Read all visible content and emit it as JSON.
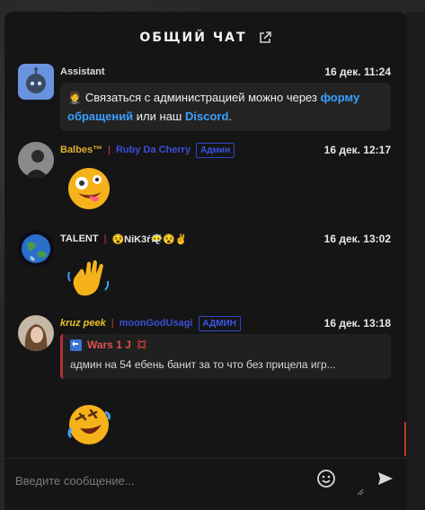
{
  "header": {
    "title": "ОБЩИЙ ЧАТ",
    "popout_icon": "external-link-icon"
  },
  "messages": [
    {
      "author": "Assistant",
      "time": "16 дек. 11:24",
      "text_prefix": "Связаться с администрацией можно через ",
      "link1": "форму обращений",
      "text_middle": " или наш ",
      "link2": "Discord",
      "text_suffix": ".",
      "prefix_icon": "person-in-suit-emoji"
    },
    {
      "author": "Balbes™",
      "nick": "Ruby Da Cherry",
      "badge": "Админ",
      "time": "16 дек. 12:17",
      "emoji": "zany-face-emoji"
    },
    {
      "author": "TALENT",
      "nick": "😵NiK3ŕ😶‍🌫️😵✌️",
      "time": "16 дек. 13:02",
      "emoji": "waving-hand-emoji"
    },
    {
      "author": "kruz peek",
      "nick": "moonGodUsagi",
      "badge": "АДМИН",
      "time": "16 дек. 13:18",
      "reply_user": "Wars 1 J",
      "reply_text": "админ на 54 ебень банит за то что без прицела игр...",
      "emoji": "rolling-on-floor-laughing-emoji"
    }
  ],
  "composer": {
    "placeholder": "Введите сообщение...",
    "emoji_icon": "smiley-icon",
    "send_icon": "send-icon"
  },
  "colors": {
    "accent_link": "#3aa0ff",
    "admin_badge": "#3a56e6",
    "separator": "#d13a3a"
  }
}
